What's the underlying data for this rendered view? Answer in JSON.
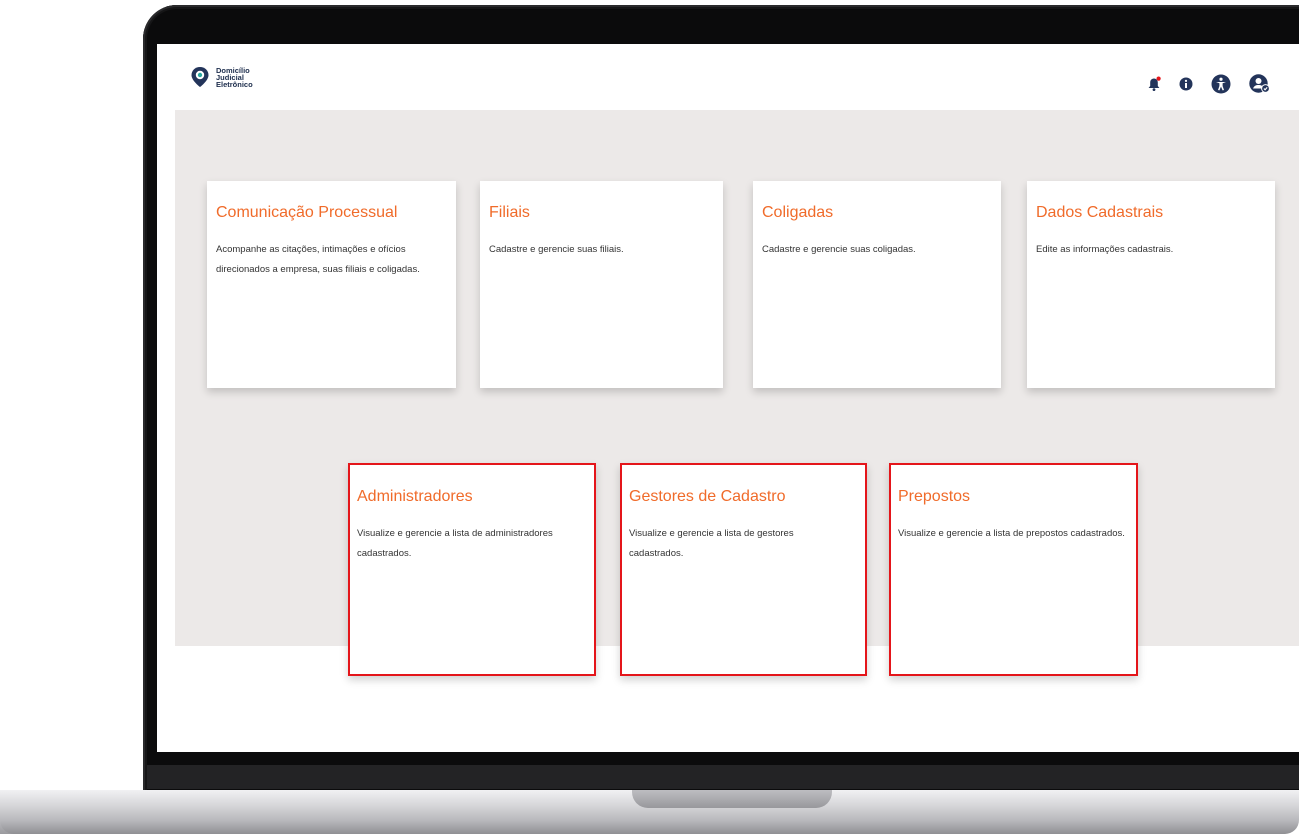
{
  "header": {
    "logo_lines": [
      "Domicílio",
      "Judicial",
      "Eletrônico"
    ],
    "icons": [
      "bell-icon",
      "info-icon",
      "accessibility-icon",
      "user-settings-icon"
    ],
    "notification_dot_color": "#e4151a"
  },
  "colors": {
    "accent": "#f06b2a",
    "navy": "#23345a",
    "highlight": "#e4151a",
    "content_bg": "#ece9e8"
  },
  "cards": [
    {
      "title": "Comunicação Processual",
      "description": "Acompanhe as citações, intimações e ofícios direcionados a empresa, suas filiais e coligadas.",
      "highlighted": false
    },
    {
      "title": "Filiais",
      "description": "Cadastre e gerencie suas filiais.",
      "highlighted": false
    },
    {
      "title": "Coligadas",
      "description": "Cadastre e gerencie suas coligadas.",
      "highlighted": false
    },
    {
      "title": "Dados Cadastrais",
      "description": "Edite as informações cadastrais.",
      "highlighted": false
    },
    {
      "title": "Administradores",
      "description": "Visualize e gerencie a lista de administradores cadastrados.",
      "highlighted": true
    },
    {
      "title": "Gestores de Cadastro",
      "description": "Visualize e gerencie a lista de gestores cadastrados.",
      "highlighted": true
    },
    {
      "title": "Prepostos",
      "description": "Visualize e gerencie a lista de prepostos cadastrados.",
      "highlighted": true
    }
  ]
}
